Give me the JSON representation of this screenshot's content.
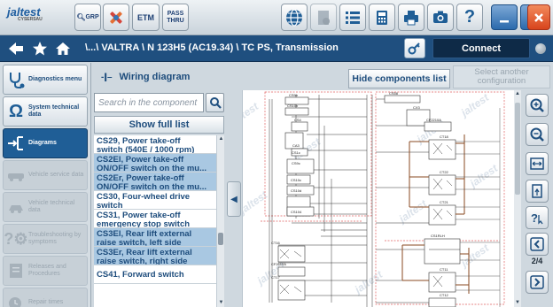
{
  "app": {
    "logo": "jaltest",
    "logo_sub": "CYSERSAU"
  },
  "toolbar": {
    "grp_label": "GRP",
    "etm_label": "ETM",
    "pass_thru_label_1": "PASS",
    "pass_thru_label_2": "THRU"
  },
  "nav": {
    "path": "\\...\\ VALTRA \\ N 123H5 (AC19.34) \\ TC PS, Transmission",
    "connect_label": "Connect"
  },
  "sidebar": {
    "items": [
      {
        "label": "Diagnostics menu",
        "state": "normal"
      },
      {
        "label": "System technical data",
        "state": "normal"
      },
      {
        "label": "Diagrams",
        "state": "active"
      },
      {
        "label": "Vehicle service data",
        "state": "disabled"
      },
      {
        "label": "Vehicle technical data",
        "state": "disabled"
      },
      {
        "label": "Troubleshooting by symptoms",
        "state": "disabled"
      },
      {
        "label": "Releases and Procedures",
        "state": "disabled"
      },
      {
        "label": "Repair times",
        "state": "disabled"
      }
    ]
  },
  "components": {
    "title": "Wiring diagram",
    "search_placeholder": "Search in the component l...",
    "full_list_label": "Show full list",
    "items": [
      {
        "text1": "CS29, Power take-off",
        "text2": "switch (540E / 1000 rpm)",
        "selected": false
      },
      {
        "text1": "CS2El, Power take-off",
        "text2": "ON/OFF switch on the mu...",
        "selected": true
      },
      {
        "text1": "CS2Er, Power take-off",
        "text2": "ON/OFF switch on the mu...",
        "selected": true
      },
      {
        "text1": "CS30, Four-wheel drive",
        "text2": "switch",
        "selected": false
      },
      {
        "text1": "CS31, Power take-off",
        "text2": "emergency stop switch",
        "selected": false
      },
      {
        "text1": "CS3El, Rear lift external",
        "text2": "raise switch, left side",
        "selected": true
      },
      {
        "text1": "CS3Er, Rear lift external",
        "text2": "raise switch, right side",
        "selected": true
      },
      {
        "text1": "CS41, Forward switch",
        "text2": "",
        "selected": false
      }
    ]
  },
  "diagram_header": {
    "hide_components_label": "Hide components list",
    "select_config_line1": "Select another",
    "select_config_line2": "configuration"
  },
  "diagram": {
    "watermark": "jaltest",
    "labels": [
      "CS9b",
      "CS10b",
      "CS4",
      "CA3",
      "CS1c",
      "CS9c",
      "CS10c",
      "CS10d",
      "CS104",
      "CT16",
      "CF2610A",
      "CT17",
      "CS58",
      "CX3",
      "CF2210A",
      "CT18",
      "CT22",
      "CT21",
      "CS1RLH",
      "CT11",
      "CT12"
    ],
    "page": "2/4"
  }
}
